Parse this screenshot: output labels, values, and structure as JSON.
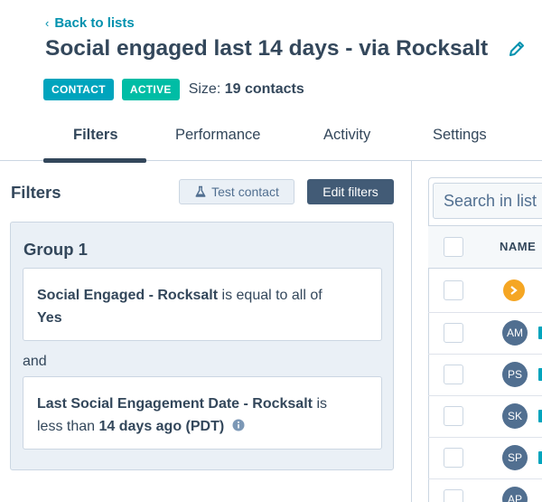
{
  "header": {
    "back_label": "Back to lists",
    "title": "Social engaged last 14 days - via Rocksalt",
    "badge_contact": "CONTACT",
    "badge_active": "ACTIVE",
    "size_label": "Size:",
    "size_value": "19 contacts"
  },
  "tabs": [
    {
      "label": "Filters",
      "active": true
    },
    {
      "label": "Performance",
      "active": false
    },
    {
      "label": "Activity",
      "active": false
    },
    {
      "label": "Settings",
      "active": false
    }
  ],
  "filters_panel": {
    "heading": "Filters",
    "test_contact_label": "Test contact",
    "edit_filters_label": "Edit filters",
    "group": {
      "title": "Group 1",
      "conjunction": "and",
      "filters": [
        {
          "property": "Social Engaged - Rocksalt",
          "operator": "is equal to all of",
          "value": "Yes"
        },
        {
          "property": "Last Social Engagement Date - Rocksalt",
          "operator_part1": "is",
          "operator_part2": "less than",
          "value": "14 days ago (PDT)"
        }
      ]
    }
  },
  "records_table": {
    "search_placeholder": "Search in list",
    "column_name": "NAME",
    "avatars": [
      "",
      "AM",
      "PS",
      "SK",
      "SP",
      "AP"
    ]
  },
  "colors": {
    "accent": "#0091ae",
    "badge_contact": "#00a4bd",
    "badge_active": "#00bda5",
    "primary_button": "#425b76",
    "text": "#33475b"
  }
}
